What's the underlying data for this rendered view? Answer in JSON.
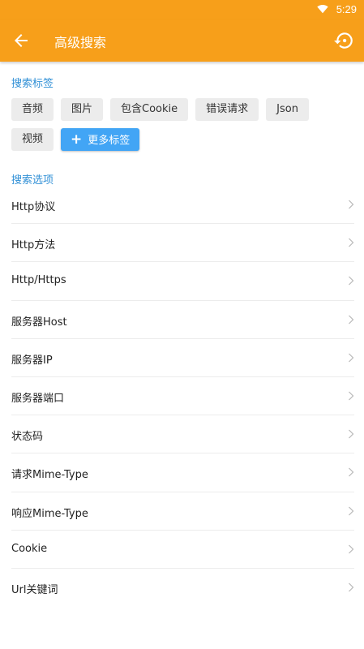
{
  "status_bar": {
    "time": "5:29",
    "wifi_icon": "wifi-icon"
  },
  "app_bar": {
    "title": "高级搜索",
    "back_icon": "arrow-left-icon",
    "reset_icon": "history-reset-icon",
    "color": "#f79f1a"
  },
  "tags_section": {
    "title": "搜索标签",
    "rows": [
      [
        "音频",
        "图片",
        "包含Cookie",
        "错误请求",
        "Json"
      ],
      [
        "视频"
      ]
    ],
    "more_button": {
      "plus": "+",
      "label": "更多标签"
    }
  },
  "options_section": {
    "title": "搜索选项",
    "items": [
      "Http协议",
      "Http方法",
      "Http/Https",
      "服务器Host",
      "服务器IP",
      "服务器端口",
      "状态码",
      "请求Mime-Type",
      "响应Mime-Type",
      "Cookie",
      "Url关键词"
    ]
  },
  "colors": {
    "accent": "#f79f1a",
    "section_title": "#2f8fd6",
    "more_button": "#42a5f5",
    "tag_bg": "#ececec"
  }
}
